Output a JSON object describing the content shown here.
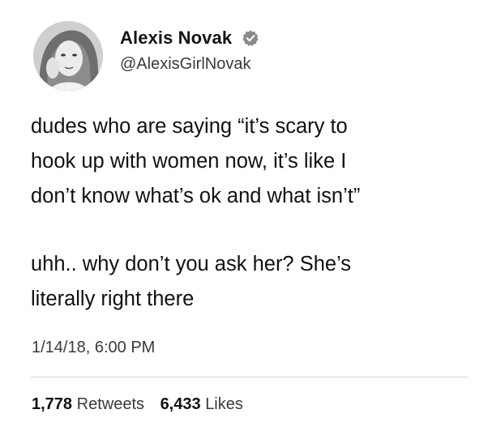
{
  "author": {
    "display_name": "Alexis Novak",
    "handle": "@AlexisGirlNovak",
    "verified": true,
    "avatar_icon": "profile-photo-grayscale"
  },
  "tweet": {
    "paragraphs": [
      {
        "lines": [
          "dudes who are saying “it’s scary to",
          "hook up with women now, it’s like I",
          "don’t know what’s ok and what isn’t”"
        ]
      },
      {
        "lines": [
          "uhh.. why don’t you ask her? She’s",
          "literally right there"
        ]
      }
    ],
    "timestamp": "1/14/18, 6:00 PM"
  },
  "stats": {
    "retweets_count": "1,778",
    "retweets_label": "Retweets",
    "likes_count": "6,433",
    "likes_label": "Likes"
  },
  "colors": {
    "text": "#141414",
    "secondary_text": "#3a3a3a",
    "divider": "#d4d4d4",
    "verified_badge": "#8a8a8a"
  }
}
